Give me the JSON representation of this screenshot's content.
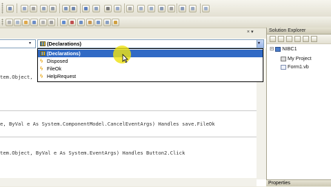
{
  "dropdown": {
    "selected": "(Declarations)",
    "items": [
      {
        "label": "(Declarations)",
        "icon": "declarations-icon"
      },
      {
        "label": "Disposed",
        "icon": "event-icon"
      },
      {
        "label": "FileOk",
        "icon": "event-icon"
      },
      {
        "label": "HelpRequest",
        "icon": "event-icon"
      }
    ]
  },
  "code": {
    "line1": "tem.Object, ",
    "line2": "e, ByVal e As System.ComponentModel.CancelEventArgs) Handles save.FileOk",
    "line3": "tem.Object, ByVal e As System.EventArgs) Handles Button2.Click"
  },
  "solution_explorer": {
    "title": "Solution Explorer",
    "project_root": "NIBC1",
    "items": [
      "My Project",
      "Form1.vb"
    ]
  },
  "properties": {
    "title": "Properties"
  },
  "panel_controls": {
    "pin": "▾ ⊥ ×"
  },
  "colors": {
    "selection": "#316ac5",
    "highlight": "#eee214"
  }
}
